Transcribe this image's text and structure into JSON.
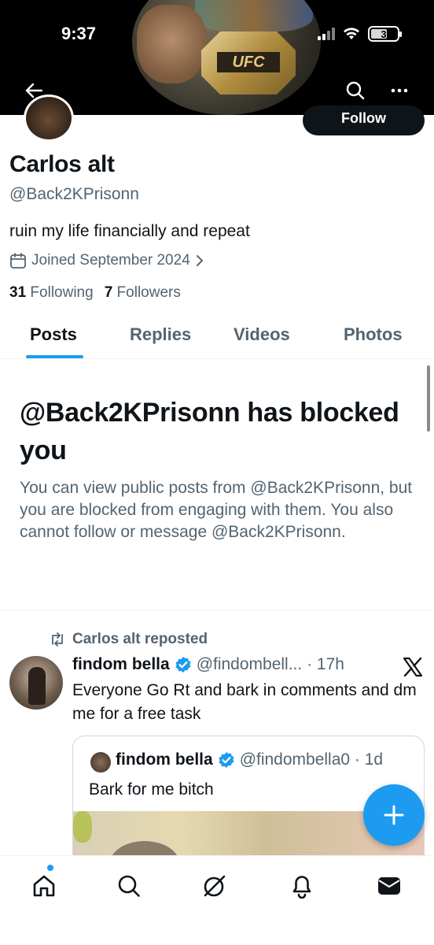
{
  "status_bar": {
    "time": "9:37",
    "battery": "3"
  },
  "banner": {
    "belt_label": "UFC"
  },
  "top_nav": {
    "back_icon": "arrow-left-icon",
    "search_icon": "search-icon",
    "more_icon": "more-dots-icon"
  },
  "profile": {
    "display_name": "Carlos alt",
    "handle": "@Back2KPrisonn",
    "bio": "ruin my life financially and repeat",
    "joined": "Joined September 2024",
    "following_count": "31",
    "following_label": "Following",
    "followers_count": "7",
    "followers_label": "Followers",
    "follow_button": "Follow"
  },
  "tabs": [
    {
      "label": "Posts",
      "active": true
    },
    {
      "label": "Replies",
      "active": false
    },
    {
      "label": "Videos",
      "active": false
    },
    {
      "label": "Photos",
      "active": false
    }
  ],
  "blocked": {
    "title": "@Back2KPrisonn has blocked you",
    "body": "You can view public posts from @Back2KPrisonn, but you are blocked from engaging with them. You also cannot follow or message @Back2KPrisonn."
  },
  "post": {
    "repost_label": "Carlos alt reposted",
    "author_name": "findom bella",
    "author_meta": "@findombell... · 17h",
    "text": "Everyone Go Rt and bark in comments and dm me for a free task",
    "quote": {
      "author_name": "findom bella",
      "author_meta": "@findombella0 · 1d",
      "text": "Bark for me bitch"
    }
  },
  "colors": {
    "accent": "#1d9bf0",
    "text": "#0f1419",
    "secondary": "#536471",
    "border": "#eff3f4"
  },
  "bottom_nav": [
    "home-icon",
    "search-icon",
    "grok-icon",
    "notifications-icon",
    "messages-icon"
  ]
}
